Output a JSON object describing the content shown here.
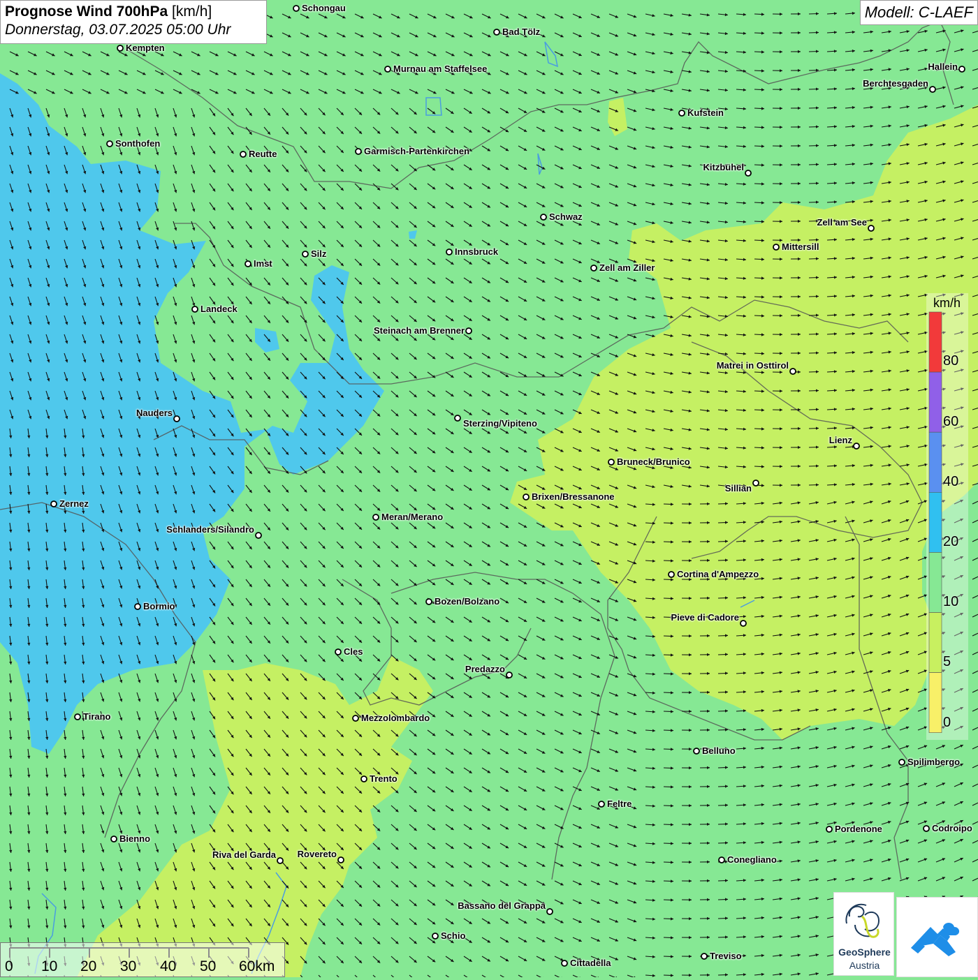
{
  "header": {
    "title_bold": "Prognose Wind 700hPa",
    "title_unit": "[km/h]",
    "datetime": "Donnerstag, 03.07.2025 05:00 Uhr"
  },
  "model": "Modell: C-LAEF",
  "legend": {
    "unit": "km/h",
    "labels": [
      "80",
      "60",
      "40",
      "20",
      "10",
      "5",
      "0"
    ],
    "colors": [
      "#f23a3a",
      "#9060e8",
      "#5a90f0",
      "#30c0f0",
      "#86e894",
      "#c8f060",
      "#f8f068"
    ]
  },
  "colors": {
    "background_green": "#86e894",
    "wind_blue": "#4cc6f0",
    "wind_yellowgreen": "#c8f060",
    "borders": "#555555"
  },
  "scale_bar": {
    "labels": [
      "0",
      "10",
      "20",
      "30",
      "40",
      "50",
      "60km"
    ]
  },
  "cities": [
    {
      "name": "Schongau"
    },
    {
      "name": "Bad Tölz"
    },
    {
      "name": "Kempten"
    },
    {
      "name": "Murnau am Staffelsee"
    },
    {
      "name": "Hallein"
    },
    {
      "name": "Berchtesgaden"
    },
    {
      "name": "Kufstein"
    },
    {
      "name": "Sonthofen"
    },
    {
      "name": "Reutte"
    },
    {
      "name": "Garmisch-Partenkirchen"
    },
    {
      "name": "Kitzbühel"
    },
    {
      "name": "Schwaz"
    },
    {
      "name": "Zell am See"
    },
    {
      "name": "Mittersill"
    },
    {
      "name": "Innsbruck"
    },
    {
      "name": "Silz"
    },
    {
      "name": "Imst"
    },
    {
      "name": "Zell am Ziller"
    },
    {
      "name": "Landeck"
    },
    {
      "name": "Steinach am Brenner"
    },
    {
      "name": "Matrei in Osttirol"
    },
    {
      "name": "Nauders"
    },
    {
      "name": "Sterzing/Vipiteno"
    },
    {
      "name": "Lienz"
    },
    {
      "name": "Bruneck/Brunico"
    },
    {
      "name": "Sillian"
    },
    {
      "name": "Brixen/Bressanone"
    },
    {
      "name": "Zernez"
    },
    {
      "name": "Meran/Merano"
    },
    {
      "name": "Schlanders/Silandro"
    },
    {
      "name": "Cortina d'Ampezzo"
    },
    {
      "name": "Bozen/Bolzano"
    },
    {
      "name": "Bormio"
    },
    {
      "name": "Pieve di Cadore"
    },
    {
      "name": "Cles"
    },
    {
      "name": "Predazzo"
    },
    {
      "name": "Tirano"
    },
    {
      "name": "Mezzolombardo"
    },
    {
      "name": "Belluno"
    },
    {
      "name": "Spilimbergo"
    },
    {
      "name": "Trento"
    },
    {
      "name": "Feltre"
    },
    {
      "name": "Bienno"
    },
    {
      "name": "Pordenone"
    },
    {
      "name": "Codroipo"
    },
    {
      "name": "Riva del Garda"
    },
    {
      "name": "Rovereto"
    },
    {
      "name": "Conegliano"
    },
    {
      "name": "Bassano del Grappa"
    },
    {
      "name": "Schio"
    },
    {
      "name": "Treviso"
    },
    {
      "name": "Cittadella"
    }
  ],
  "logos": {
    "geosphere_line1": "GeoSphere",
    "geosphere_line2": "Austria"
  }
}
